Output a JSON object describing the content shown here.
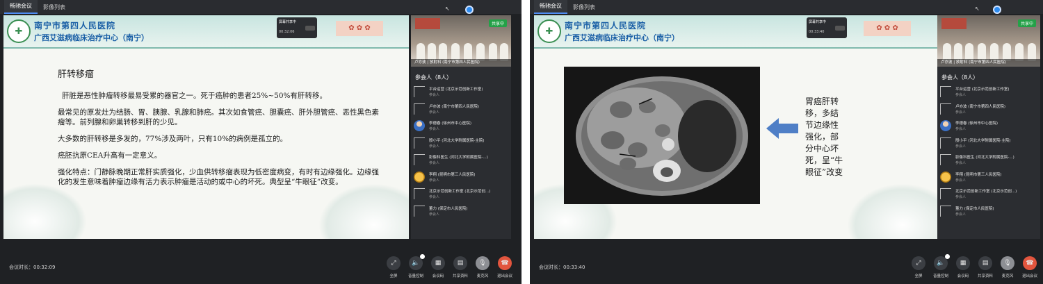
{
  "windows": [
    {
      "tabs": [
        "畅驰会议",
        "影像列表"
      ],
      "slide": {
        "hospital_name": "南宁市第四人民医院",
        "hospital_subtitle": "广西艾滋病临床治疗中心（南宁）",
        "sharing_status": "屏幕共享中",
        "sharing_time": "00:32:06",
        "title": "肝转移瘤",
        "paragraphs": [
          "肝脏是恶性肿瘤转移最易受累的器官之一。死于癌肿的患者25%~50%有肝转移。",
          "最常见的原发灶为结肠、胃、胰腺、乳腺和肺癌。其次如食管癌、胆囊癌、肝外胆管癌、恶性黑色素瘤等。前列腺和卵巢转移到肝的少见。",
          "大多数的肝转移是多发的，77%涉及两叶，只有10%的病例是孤立的。",
          "癌胚抗原CEA升高有一定意义。",
          "强化特点：门静脉晚期正常肝实质强化，少血供转移瘤表现为低密度病变，有时有边缘强化。边缘强化的发生意味着肿瘤边缘有活力表示肿瘤是活动的或中心的坏死。典型呈“牛眼征”改变。"
        ]
      },
      "video": {
        "badge": "共享中",
        "caption": "卢亦波 | 放射科 (南宁市第四人民医院)"
      },
      "participants_title": "参会人（8人）",
      "participants": [
        {
          "name": "平台运营 (北京示范创新工作室)",
          "role": "参会人"
        },
        {
          "name": "卢亦波 (南宁市第四人民医院)",
          "role": "参会人"
        },
        {
          "name": "李德春 (徐州市中心医院)",
          "role": "参会人"
        },
        {
          "name": "殷小平 (河北大学附属医院-主院)",
          "role": "参会人"
        },
        {
          "name": "影像科医生 (河北大学附属医院-...)",
          "role": "参会人"
        },
        {
          "name": "李翔 (昆明市第三人民医院)",
          "role": "参会人"
        },
        {
          "name": "北京示范创新工作室 (北京示范创...)",
          "role": "参会人"
        },
        {
          "name": "董力 (保定市人民医院)",
          "role": "参会人"
        }
      ],
      "duration": "会议时长：00:32:09",
      "controls": [
        "全屏",
        "音量控制",
        "会议码",
        "共享资料",
        "麦克风",
        "退出会议"
      ]
    },
    {
      "tabs": [
        "畅驰会议",
        "影像列表"
      ],
      "slide": {
        "hospital_name": "南宁市第四人民医院",
        "hospital_subtitle": "广西艾滋病临床治疗中心（南宁）",
        "sharing_status": "屏幕共享中",
        "sharing_time": "00:33:40",
        "ct_caption": "胃癌肝转移，多结节边缘性强化，部分中心坏死，呈“牛眼征”改变"
      },
      "video": {
        "badge": "共享中",
        "caption": "卢亦波 | 放射科 (南宁市第四人民医院)"
      },
      "participants_title": "参会人（8人）",
      "participants": [
        {
          "name": "平台运营 (北京示范创新工作室)",
          "role": "参会人"
        },
        {
          "name": "卢亦波 (南宁市第四人民医院)",
          "role": "参会人"
        },
        {
          "name": "李德春 (徐州市中心医院)",
          "role": "参会人"
        },
        {
          "name": "殷小平 (河北大学附属医院-主院)",
          "role": "参会人"
        },
        {
          "name": "影像科医生 (河北大学附属医院-...)",
          "role": "参会人"
        },
        {
          "name": "李翔 (昆明市第三人民医院)",
          "role": "参会人"
        },
        {
          "name": "北京示范创新工作室 (北京示范创...)",
          "role": "参会人"
        },
        {
          "name": "董力 (保定市人民医院)",
          "role": "参会人"
        }
      ],
      "duration": "会议时长：00:33:40",
      "controls": [
        "全屏",
        "音量控制",
        "会议码",
        "共享资料",
        "麦克风",
        "退出会议"
      ]
    }
  ],
  "colors": {
    "accent": "#4e8df5",
    "end_call": "#e2553e",
    "panel": "#2b2d31",
    "background": "#1f2124"
  }
}
